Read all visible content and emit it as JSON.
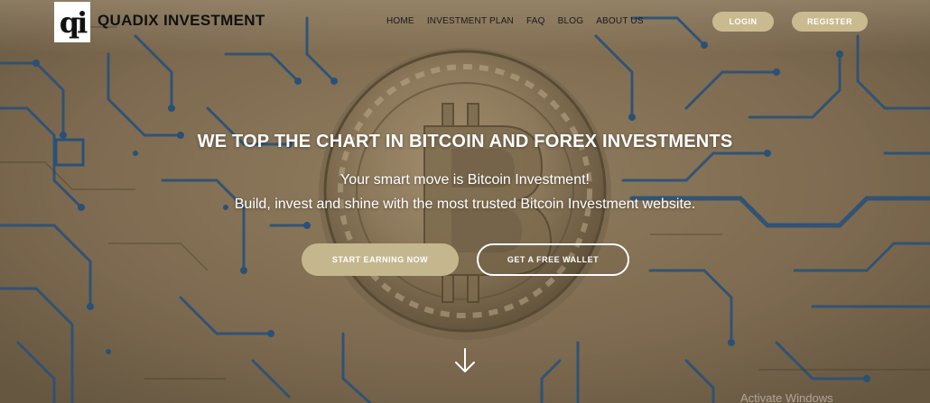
{
  "brand": {
    "logo_glyph": "qi",
    "name": "QUADIX INVESTMENT"
  },
  "nav": {
    "items": [
      "HOME",
      "INVESTMENT PLAN",
      "FAQ",
      "BLOG",
      "ABOUT US"
    ]
  },
  "header_buttons": {
    "login": "LOGIN",
    "register": "REGISTER"
  },
  "hero": {
    "headline": "WE TOP THE CHART IN BITCOIN AND FOREX INVESTMENTS",
    "subline_1": "Your smart move is Bitcoin Investment!",
    "subline_2": "Build, invest and shine with the most trusted Bitcoin Investment website.",
    "cta_primary": "START EARNING NOW",
    "cta_secondary": "GET A FREE WALLET"
  },
  "system": {
    "watermark": "Activate Windows"
  },
  "colors": {
    "accent_gold": "#c9bb8f",
    "circuit_blue": "#1f4c7a",
    "background_tan": "#8a7658"
  },
  "icons": {
    "scroll_down": "arrow-down-icon",
    "hero_image": "bitcoin-coin-icon"
  }
}
